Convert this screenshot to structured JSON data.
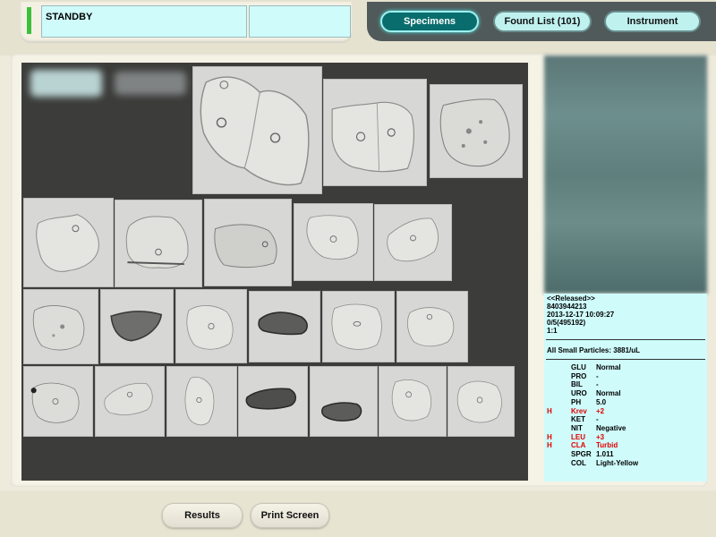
{
  "status": {
    "text": "STANDBY",
    "indicator_color": "#3cbf3c"
  },
  "tabs": [
    {
      "label": "Specimens",
      "active": true
    },
    {
      "label": "Found List (101)",
      "active": false
    },
    {
      "label": "Instrument",
      "active": false
    }
  ],
  "specimen": {
    "release": "<<Released>>",
    "id": "8403944213",
    "datetime": "2013-12-17 10:09:27",
    "code": "0/5(495192)",
    "ratio": "1:1",
    "particles": "All Small Particles: 3881/uL"
  },
  "urinalysis": [
    {
      "flag": "",
      "name": "GLU",
      "value": "Normal",
      "abnormal": false
    },
    {
      "flag": "",
      "name": "PRO",
      "value": "-",
      "abnormal": false
    },
    {
      "flag": "",
      "name": "BIL",
      "value": "-",
      "abnormal": false
    },
    {
      "flag": "",
      "name": "URO",
      "value": "Normal",
      "abnormal": false
    },
    {
      "flag": "",
      "name": "PH",
      "value": "5.0",
      "abnormal": false
    },
    {
      "flag": "H",
      "name": "Krev",
      "value": "+2",
      "abnormal": true
    },
    {
      "flag": "",
      "name": "KET",
      "value": "-",
      "abnormal": false
    },
    {
      "flag": "",
      "name": "NIT",
      "value": "Negative",
      "abnormal": false
    },
    {
      "flag": "H",
      "name": "LEU",
      "value": "+3",
      "abnormal": true
    },
    {
      "flag": "H",
      "name": "CLA",
      "value": "Turbid",
      "abnormal": true
    },
    {
      "flag": "",
      "name": "SPGR",
      "value": "1.011",
      "abnormal": false
    },
    {
      "flag": "",
      "name": "COL",
      "value": "Light-Yellow",
      "abnormal": false
    }
  ],
  "bottom": {
    "results_label": "Results",
    "print_label": "Print Screen"
  }
}
